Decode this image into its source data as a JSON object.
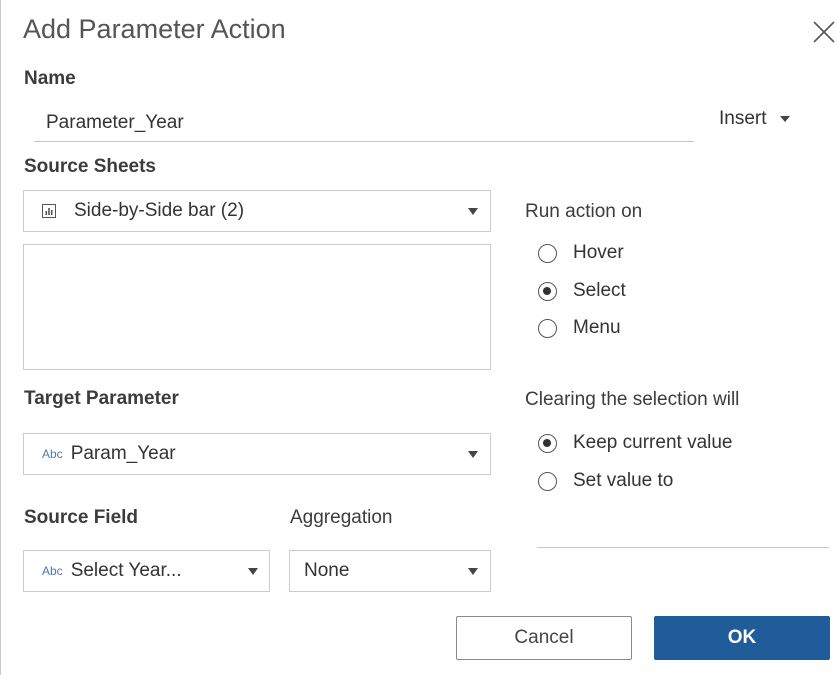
{
  "dialog": {
    "title": "Add Parameter Action",
    "close_icon": "close-icon"
  },
  "name_section": {
    "label": "Name",
    "value": "Parameter_Year",
    "insert_label": "Insert",
    "insert_icon": "caret-down-icon"
  },
  "source_sheets": {
    "label": "Source Sheets",
    "selected": "Side-by-Side bar (2)",
    "icon": "worksheet-icon"
  },
  "run_action": {
    "label": "Run action on",
    "options": [
      {
        "label": "Hover",
        "checked": false
      },
      {
        "label": "Select",
        "checked": true
      },
      {
        "label": "Menu",
        "checked": false
      }
    ]
  },
  "target_parameter": {
    "label": "Target Parameter",
    "type_badge": "Abc",
    "selected": "Param_Year"
  },
  "clearing": {
    "label": "Clearing the selection will",
    "options": [
      {
        "label": "Keep current value",
        "checked": true
      },
      {
        "label": "Set value to",
        "checked": false
      }
    ]
  },
  "source_field": {
    "label": "Source Field",
    "type_badge": "Abc",
    "selected": "Select Year..."
  },
  "aggregation": {
    "label": "Aggregation",
    "selected": "None"
  },
  "buttons": {
    "cancel": "Cancel",
    "ok": "OK"
  },
  "colors": {
    "accent": "#1f5c99",
    "type_badge": "#4a7ab0",
    "border": "#cccccc"
  }
}
